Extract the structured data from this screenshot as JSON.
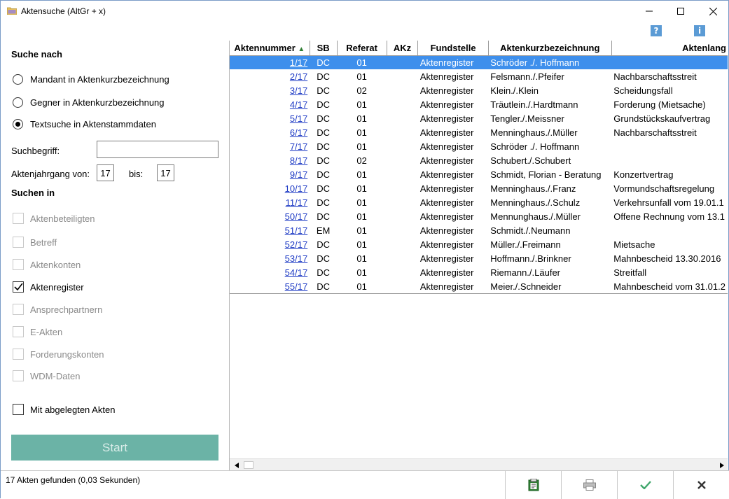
{
  "window": {
    "title": "Aktensuche (AltGr + x)",
    "minimize_icon": "minimize-icon",
    "maximize_icon": "maximize-icon",
    "close_icon": "close-icon",
    "help_label": "?",
    "info_label": "i"
  },
  "search": {
    "section_title": "Suche nach",
    "radios": [
      {
        "label": "Mandant in Aktenkurzbezeichnung",
        "checked": false
      },
      {
        "label": "Gegner in Aktenkurzbezeichnung",
        "checked": false
      },
      {
        "label": "Textsuche in Aktenstammdaten",
        "checked": true
      }
    ],
    "term_label": "Suchbegriff:",
    "term_value": "",
    "year_label": "Aktenjahrgang von:",
    "year_from": "17",
    "year_to_label": "bis:",
    "year_to": "17"
  },
  "search_in": {
    "section_title": "Suchen in",
    "items": [
      {
        "label": "Aktenbeteiligten",
        "checked": false,
        "enabled": false
      },
      {
        "label": "Betreff",
        "checked": false,
        "enabled": false
      },
      {
        "label": "Aktenkonten",
        "checked": false,
        "enabled": false
      },
      {
        "label": "Aktenregister",
        "checked": true,
        "enabled": true
      },
      {
        "label": "Ansprechpartnern",
        "checked": false,
        "enabled": false
      },
      {
        "label": "E-Akten",
        "checked": false,
        "enabled": false
      },
      {
        "label": "Forderungskonten",
        "checked": false,
        "enabled": false
      },
      {
        "label": "WDM-Daten",
        "checked": false,
        "enabled": false
      }
    ],
    "archived_label": "Mit abgelegten Akten",
    "archived_checked": false,
    "start_label": "Start"
  },
  "table": {
    "headers": [
      "Aktennummer",
      "SB",
      "Referat",
      "AKz",
      "Fundstelle",
      "Aktenkurzbezeichnung",
      "Aktenlang"
    ],
    "sort_icon": "sort-ascending-icon",
    "rows": [
      [
        "1/17",
        "DC",
        "01",
        "",
        "Aktenregister",
        "Schröder ./. Hoffmann",
        ""
      ],
      [
        "2/17",
        "DC",
        "01",
        "",
        "Aktenregister",
        "Felsmann./.Pfeifer",
        "Nachbarschaftsstreit"
      ],
      [
        "3/17",
        "DC",
        "02",
        "",
        "Aktenregister",
        "Klein./.Klein",
        "Scheidungsfall"
      ],
      [
        "4/17",
        "DC",
        "01",
        "",
        "Aktenregister",
        "Träutlein./.Hardtmann",
        "Forderung (Mietsache)"
      ],
      [
        "5/17",
        "DC",
        "01",
        "",
        "Aktenregister",
        "Tengler./.Meissner",
        "Grundstückskaufvertrag"
      ],
      [
        "6/17",
        "DC",
        "01",
        "",
        "Aktenregister",
        "Menninghaus./.Müller",
        "Nachbarschaftsstreit"
      ],
      [
        "7/17",
        "DC",
        "01",
        "",
        "Aktenregister",
        "Schröder ./. Hoffmann",
        ""
      ],
      [
        "8/17",
        "DC",
        "02",
        "",
        "Aktenregister",
        "Schubert./.Schubert",
        ""
      ],
      [
        "9/17",
        "DC",
        "01",
        "",
        "Aktenregister",
        "Schmidt, Florian - Beratung",
        "Konzertvertrag"
      ],
      [
        "10/17",
        "DC",
        "01",
        "",
        "Aktenregister",
        "Menninghaus./.Franz",
        "Vormundschaftsregelung"
      ],
      [
        "11/17",
        "DC",
        "01",
        "",
        "Aktenregister",
        "Menninghaus./.Schulz",
        "Verkehrsunfall vom 19.01.1"
      ],
      [
        "50/17",
        "DC",
        "01",
        "",
        "Aktenregister",
        "Mennunghaus./.Müller",
        "Offene Rechnung vom 13.1"
      ],
      [
        "51/17",
        "EM",
        "01",
        "",
        "Aktenregister",
        "Schmidt./.Neumann",
        ""
      ],
      [
        "52/17",
        "DC",
        "01",
        "",
        "Aktenregister",
        "Müller./.Freimann",
        "Mietsache"
      ],
      [
        "53/17",
        "DC",
        "01",
        "",
        "Aktenregister",
        "Hoffmann./.Brinkner",
        "Mahnbescheid 13.30.2016"
      ],
      [
        "54/17",
        "DC",
        "01",
        "",
        "Aktenregister",
        "Riemann./.Läufer",
        "Streitfall"
      ],
      [
        "55/17",
        "DC",
        "01",
        "",
        "Aktenregister",
        "Meier./.Schneider",
        "Mahnbescheid vom 31.01.2"
      ]
    ],
    "selected_row": 0
  },
  "status": {
    "text": "17 Akten gefunden (0,03 Sekunden)",
    "buttons": [
      {
        "name": "clipboard-button",
        "icon": "clipboard-icon"
      },
      {
        "name": "print-button",
        "icon": "printer-icon"
      },
      {
        "name": "ok-button",
        "icon": "checkmark-icon"
      },
      {
        "name": "cancel-button",
        "icon": "close-x-icon"
      }
    ]
  },
  "colors": {
    "selection": "#3e8fec",
    "link": "#1c39c4",
    "start_button": "#6bb3a6"
  }
}
